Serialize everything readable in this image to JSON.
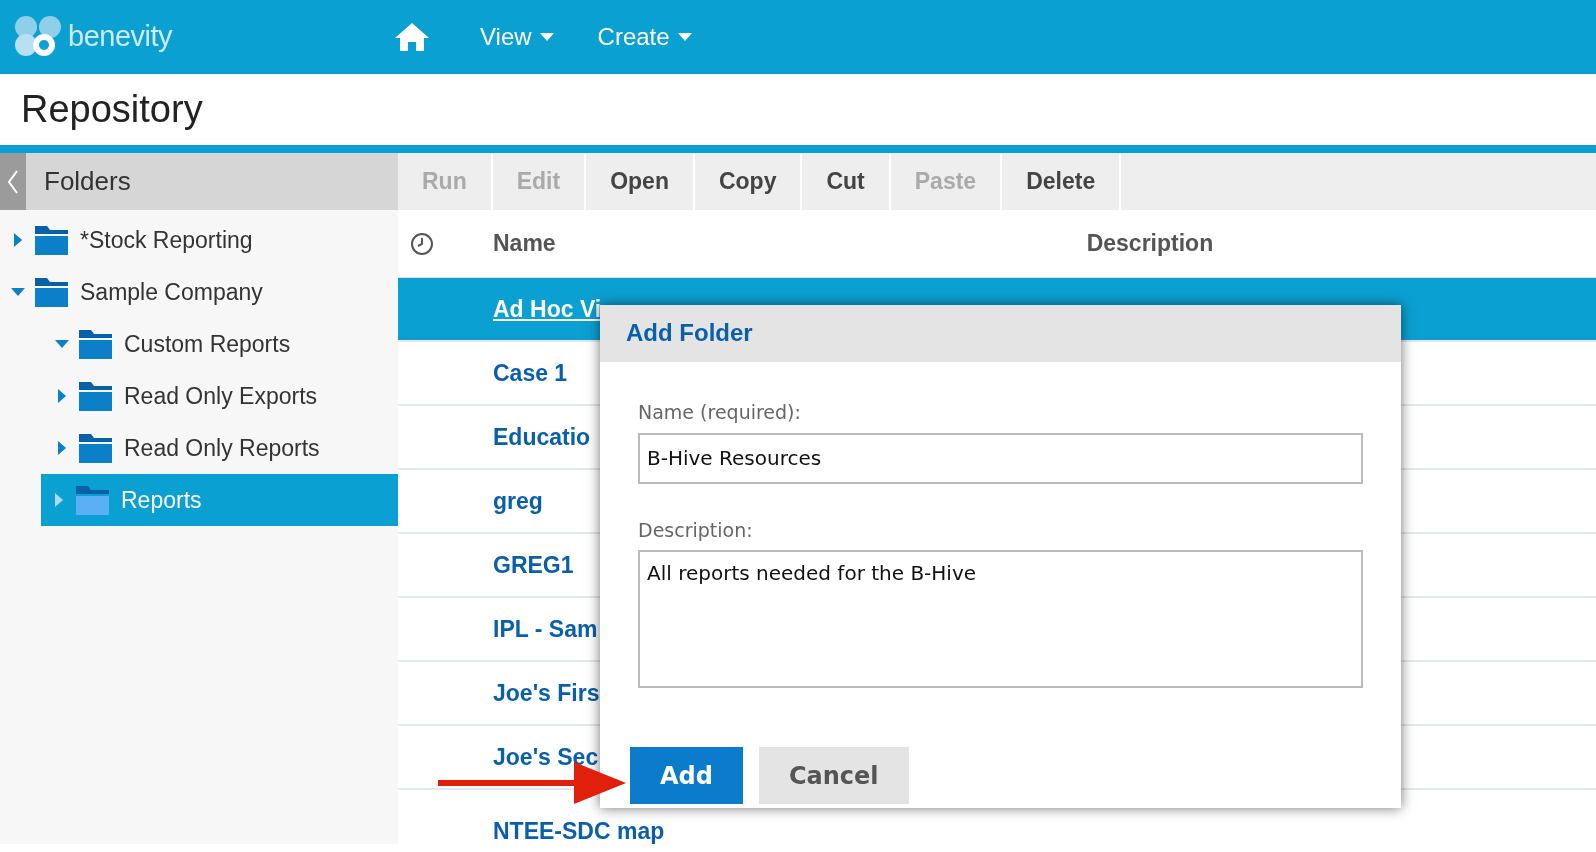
{
  "navbar": {
    "logo": "benevity",
    "menus": [
      {
        "label": "View"
      },
      {
        "label": "Create"
      }
    ]
  },
  "page_title": "Repository",
  "sidebar": {
    "title": "Folders",
    "tree": [
      {
        "label": "*Stock Reporting",
        "expanded": false,
        "selected": false
      },
      {
        "label": "Sample Company",
        "expanded": true,
        "selected": false,
        "children": [
          {
            "label": "Custom Reports",
            "expanded": true,
            "selected": false
          },
          {
            "label": "Read Only Exports",
            "expanded": false,
            "selected": false
          },
          {
            "label": "Read Only Reports",
            "expanded": false,
            "selected": false
          },
          {
            "label": "Reports",
            "expanded": false,
            "selected": true
          }
        ]
      }
    ]
  },
  "toolbar": [
    {
      "label": "Run",
      "disabled": true
    },
    {
      "label": "Edit",
      "disabled": true
    },
    {
      "label": "Open",
      "disabled": false
    },
    {
      "label": "Copy",
      "disabled": false
    },
    {
      "label": "Cut",
      "disabled": false
    },
    {
      "label": "Paste",
      "disabled": true
    },
    {
      "label": "Delete",
      "disabled": false
    }
  ],
  "table": {
    "columns": [
      "Name",
      "Description"
    ],
    "rows": [
      {
        "name": "Ad Hoc Vi",
        "selected": true
      },
      {
        "name": "Case 1",
        "selected": false
      },
      {
        "name": "Educatio",
        "selected": false
      },
      {
        "name": "greg",
        "selected": false
      },
      {
        "name": "GREG1",
        "selected": false
      },
      {
        "name": "IPL - Sam",
        "selected": false
      },
      {
        "name": "Joe's Firs",
        "selected": false
      },
      {
        "name": "Joe's Sec",
        "selected": false
      },
      {
        "name": "NTEE-SDC map",
        "selected": false
      }
    ]
  },
  "dialog": {
    "title": "Add Folder",
    "name_label": "Name (required):",
    "name_value": "B-Hive Resources",
    "description_label": "Description:",
    "description_value": "All reports needed for the B-Hive",
    "buttons": [
      {
        "label": "Add",
        "kind": "primary"
      },
      {
        "label": "Cancel",
        "kind": "secondary"
      }
    ]
  }
}
